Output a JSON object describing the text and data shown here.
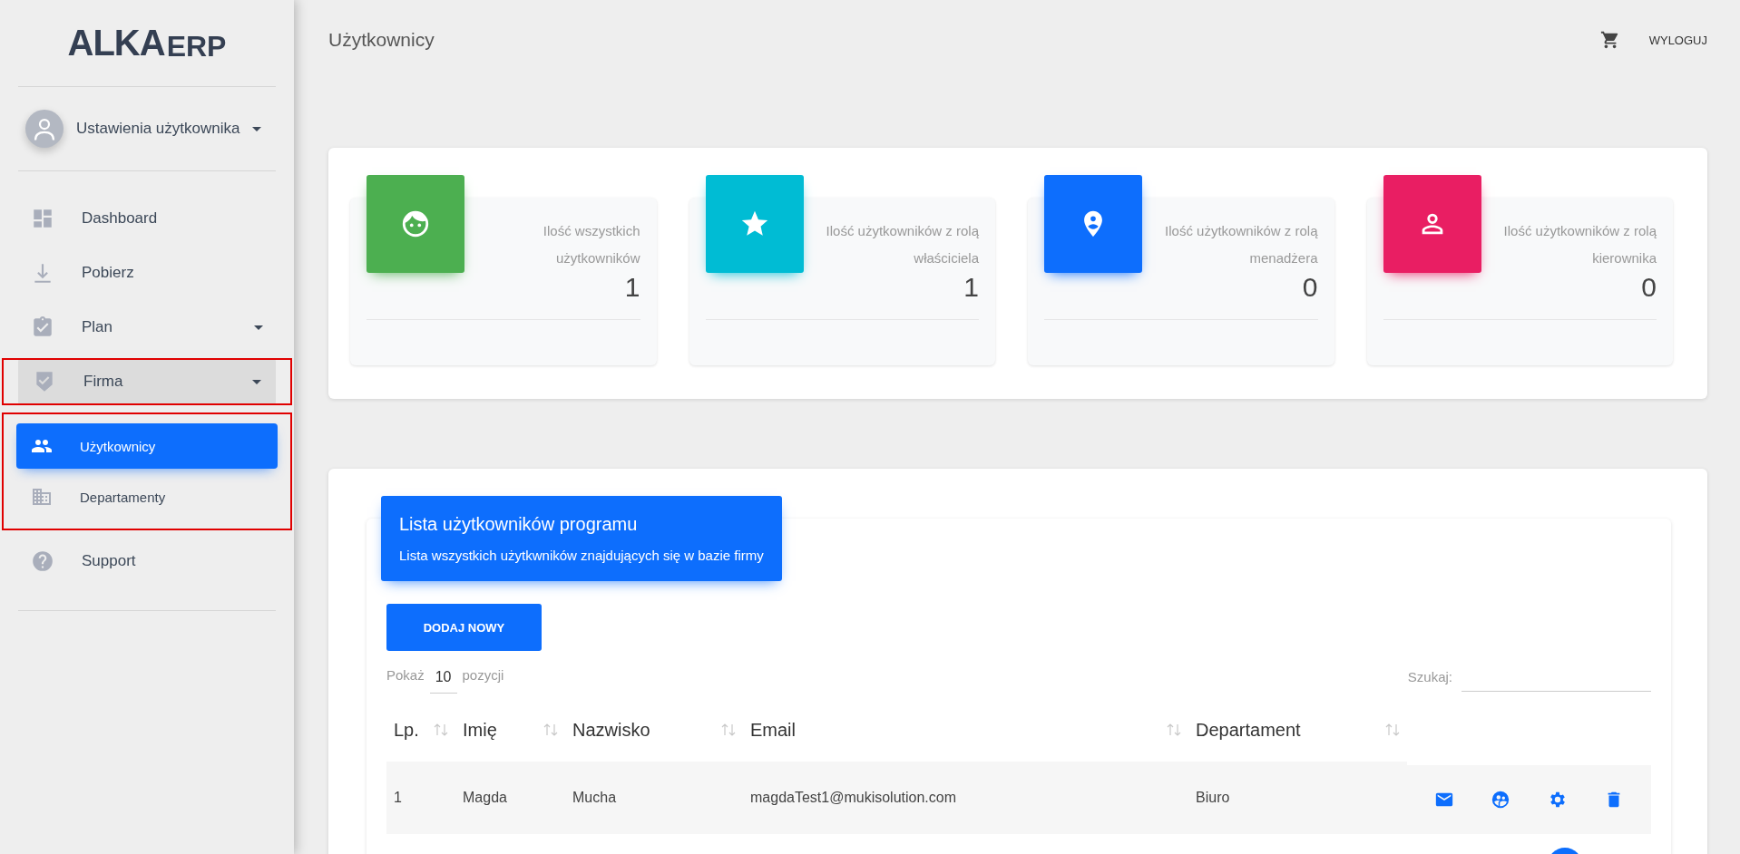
{
  "header": {
    "title": "Użytkownicy",
    "logout": "WYLOGUJ"
  },
  "sidebar": {
    "logo": {
      "main": "ALKA",
      "suffix": "ERP"
    },
    "user": {
      "label": "Ustawienia użytkownika"
    },
    "items": [
      {
        "label": "Dashboard",
        "selected": false,
        "has_caret": false
      },
      {
        "label": "Pobierz",
        "selected": false,
        "has_caret": false
      },
      {
        "label": "Plan",
        "selected": false,
        "has_caret": true,
        "expanded": false
      },
      {
        "label": "Firma",
        "selected": false,
        "has_caret": true,
        "expanded": true,
        "highlighted": true,
        "children_highlighted": true,
        "children": [
          {
            "label": "Użytkownicy",
            "selected": true
          },
          {
            "label": "Departamenty",
            "selected": false
          }
        ]
      },
      {
        "label": "Support",
        "selected": false,
        "has_caret": false
      }
    ]
  },
  "stats": [
    {
      "label": "Ilość wszystkich użytkowników",
      "value": "1",
      "color": "#4caf50"
    },
    {
      "label": "Ilość użytkowników z rolą właściciela",
      "value": "1",
      "color": "#00bcd4"
    },
    {
      "label": "Ilość użytkowników z rolą menadżera",
      "value": "0",
      "color": "#0d6efd"
    },
    {
      "label": "Ilość użytkowników z rolą kierownika",
      "value": "0",
      "color": "#e91e63"
    }
  ],
  "users_list": {
    "title": "Lista użytkowników programu",
    "subtitle": "Lista wszystkich użytkwników znajdujących się w bazie firmy",
    "add_button": "DODAJ NOWY",
    "page_length": {
      "label_before": "Pokaż",
      "value": "10",
      "label_after": "pozycji"
    },
    "search": {
      "label": "Szukaj:"
    },
    "columns": [
      "Lp.",
      "Imię",
      "Nazwisko",
      "Email",
      "Departament"
    ],
    "rows": [
      {
        "cells": [
          "1",
          "Magda",
          "Mucha",
          "magdaTest1@mukisolution.com",
          "Biuro"
        ]
      }
    ]
  }
}
